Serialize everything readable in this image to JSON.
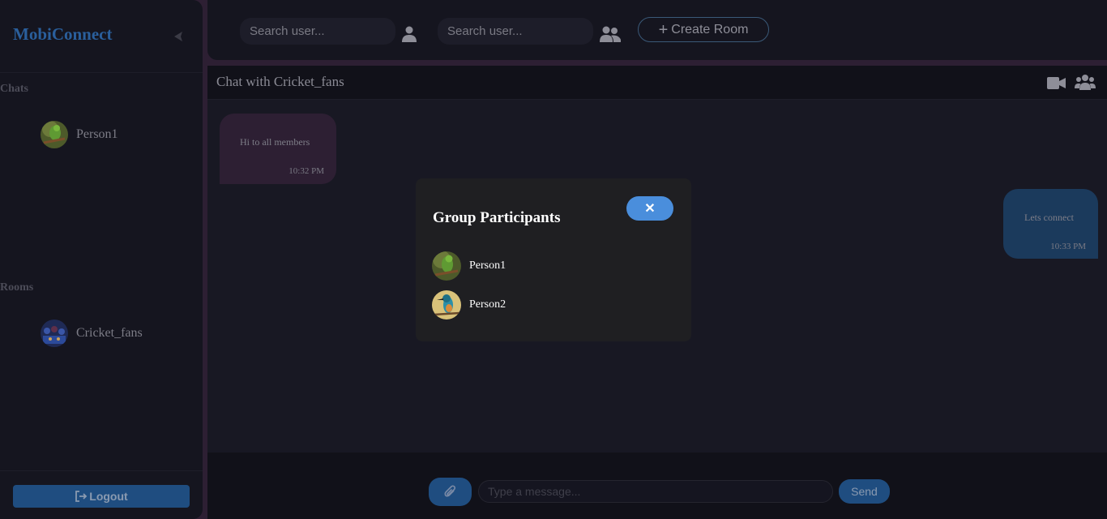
{
  "app": {
    "brand": "MobiConnect"
  },
  "sidebar": {
    "chats_label": "Chats",
    "chats": [
      {
        "name": "Person1",
        "avatar": "parrot-avatar"
      }
    ],
    "rooms_label": "Rooms",
    "rooms": [
      {
        "name": "Cricket_fans",
        "avatar": "cricket-team-avatar"
      }
    ],
    "logout_label": "Logout"
  },
  "topbar": {
    "search_user_placeholder": "Search user...",
    "search_group_placeholder": "Search user...",
    "create_room_label": "Create Room"
  },
  "chat": {
    "title": "Chat with Cricket_fans",
    "messages": [
      {
        "direction": "incoming",
        "text": "Hi to all members",
        "time": "10:32 PM"
      },
      {
        "direction": "outgoing",
        "text": "Lets connect",
        "time": "10:33 PM"
      }
    ],
    "input_placeholder": "Type a message...",
    "send_label": "Send"
  },
  "modal": {
    "title": "Group Participants",
    "close_glyph": "✕",
    "participants": [
      {
        "name": "Person1",
        "avatar": "parrot-avatar"
      },
      {
        "name": "Person2",
        "avatar": "kingfisher-avatar"
      }
    ]
  },
  "colors": {
    "accent": "#1f4d80",
    "modal_button": "#4a8edc",
    "incoming_bubble": "#2d1f33",
    "outgoing_bubble": "#1b3a5c"
  }
}
